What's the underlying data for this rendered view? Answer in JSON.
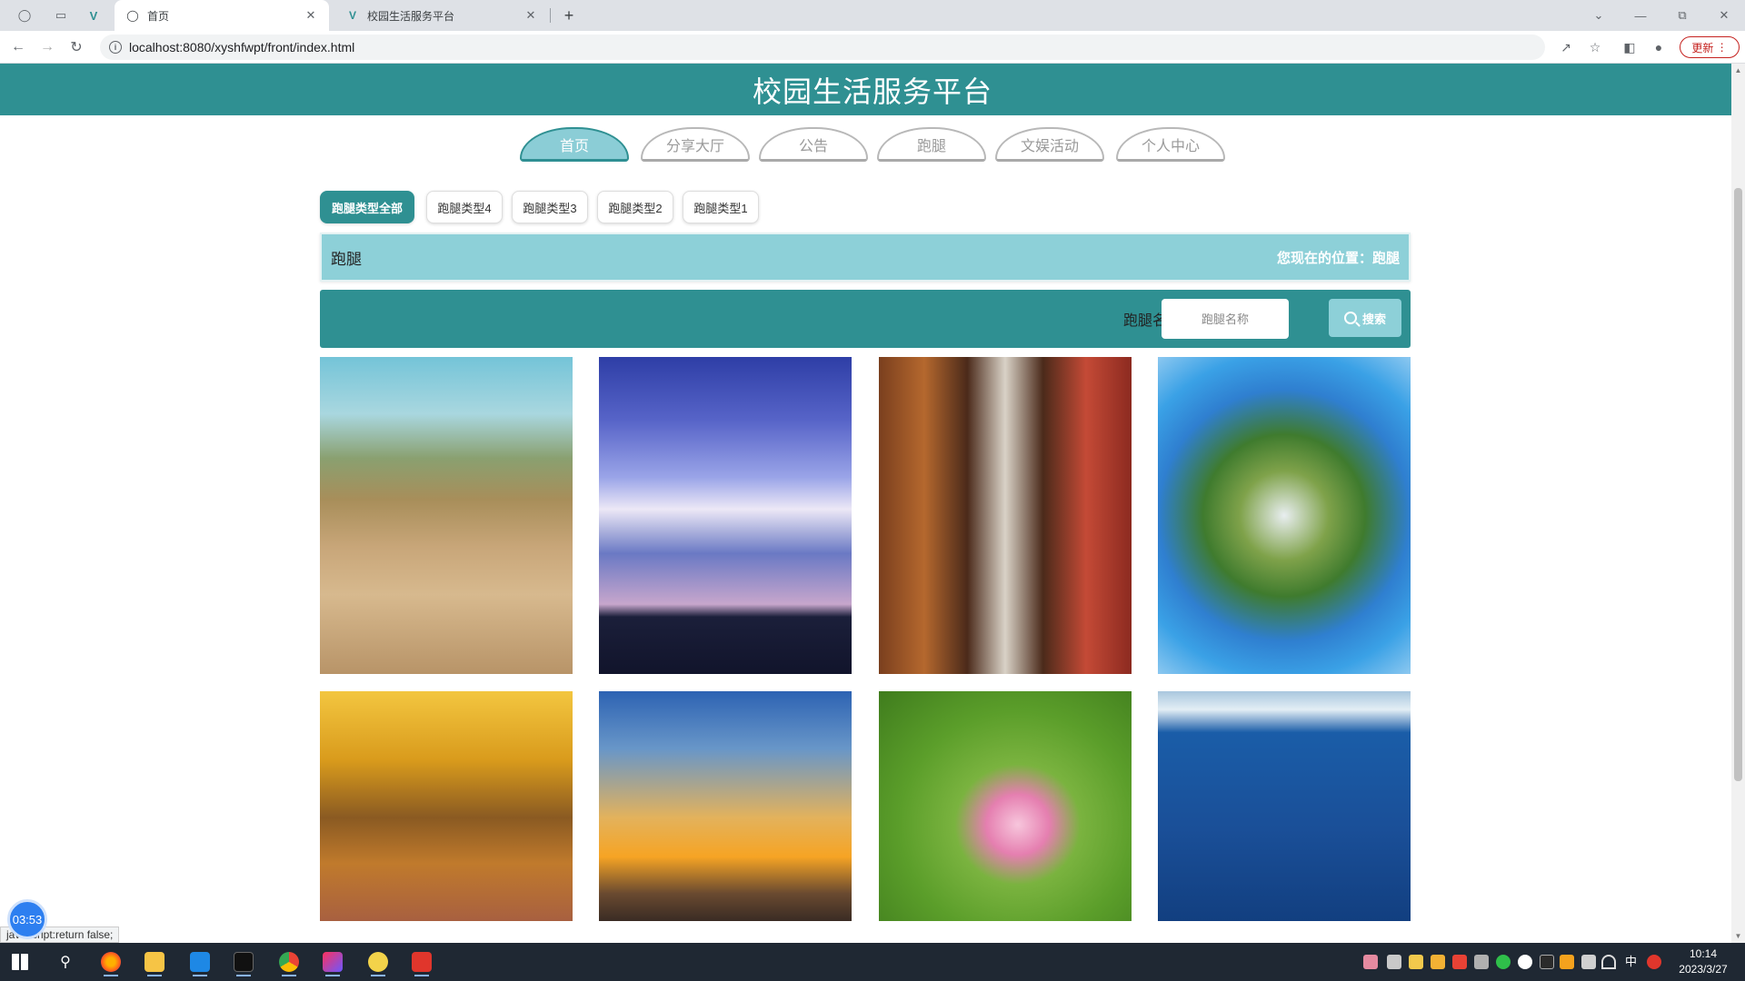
{
  "browser": {
    "tabs": [
      {
        "label": "首页",
        "active": true
      },
      {
        "label": "校园生活服务平台",
        "active": false
      }
    ],
    "new_tab": "+",
    "url": "localhost:8080/xyshfwpt/front/index.html",
    "update_label": "更新"
  },
  "site": {
    "title": "校园生活服务平台",
    "header_color": "#2f9092"
  },
  "nav": {
    "items": [
      {
        "label": "首页",
        "active": true
      },
      {
        "label": "分享大厅",
        "active": false
      },
      {
        "label": "公告",
        "active": false
      },
      {
        "label": "跑腿",
        "active": false
      },
      {
        "label": "文娱活动",
        "active": false
      },
      {
        "label": "个人中心",
        "active": false
      }
    ]
  },
  "filters": {
    "items": [
      {
        "label": "跑腿类型全部",
        "active": true
      },
      {
        "label": "跑腿类型4",
        "active": false
      },
      {
        "label": "跑腿类型3",
        "active": false
      },
      {
        "label": "跑腿类型2",
        "active": false
      },
      {
        "label": "跑腿类型1",
        "active": false
      }
    ]
  },
  "breadcrumb": {
    "title": "跑腿",
    "position": "您现在的位置：跑腿"
  },
  "search": {
    "label": "跑腿名称",
    "placeholder": "跑腿名称",
    "button_label": "搜索"
  },
  "gallery": {
    "items": [
      {
        "image": "yellow-river-waterfall"
      },
      {
        "image": "blue-sky-clouds"
      },
      {
        "image": "red-pillar-corridor"
      },
      {
        "image": "tiny-planet-tree"
      },
      {
        "image": "autumn-tree-avenue"
      },
      {
        "image": "sunset-rainbow-sea"
      },
      {
        "image": "pink-lotus"
      },
      {
        "image": "blue-lake-snow-mountain"
      }
    ]
  },
  "overlay": {
    "timer": "03:53",
    "status_link": "javascript:return false;"
  },
  "taskbar": {
    "ime": "中",
    "time": "10:14",
    "date": "2023/3/27"
  }
}
